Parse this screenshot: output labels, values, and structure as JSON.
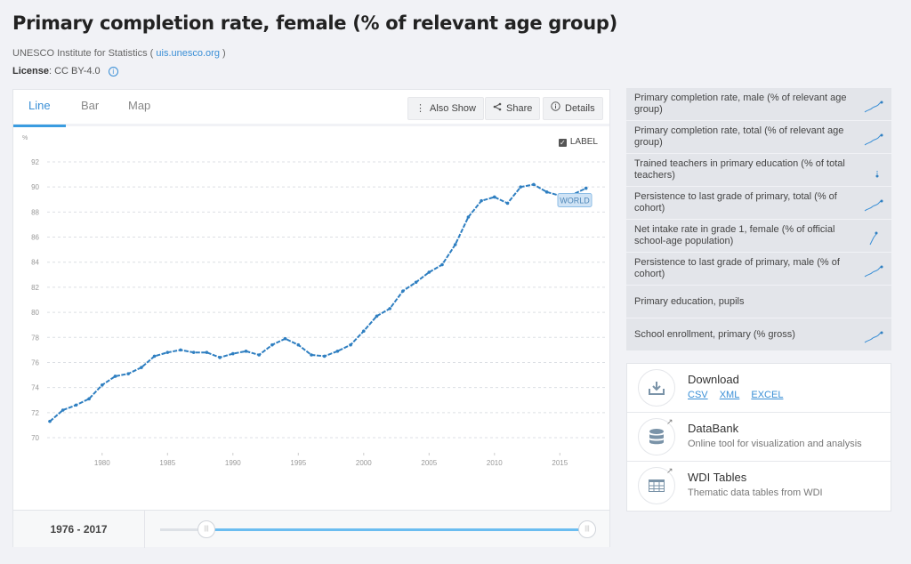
{
  "page": {
    "title": "Primary completion rate, female (% of relevant age group)",
    "source_prefix": "UNESCO Institute for Statistics (",
    "source_link": "uis.unesco.org",
    "source_suffix": ")",
    "license_label": "License",
    "license_value": ": CC BY-4.0"
  },
  "tabs": [
    {
      "label": "Line",
      "active": true
    },
    {
      "label": "Bar",
      "active": false
    },
    {
      "label": "Map",
      "active": false
    }
  ],
  "toolbar": {
    "also_show": "Also Show",
    "share": "Share",
    "details": "Details",
    "label_toggle": "LABEL",
    "label_checked": true
  },
  "footer": {
    "range_start": "1976",
    "range_end": "2017",
    "range_text": "1976 - 2017"
  },
  "colors": {
    "accent": "#3a8fd6",
    "line": "#2f7fc1",
    "slider_fill": "#6bbdf0"
  },
  "chart_data": {
    "type": "line",
    "title": "Primary completion rate, female (% of relevant age group)",
    "xlabel": "",
    "ylabel": "%",
    "ylim": [
      70,
      92
    ],
    "xlim": [
      1976,
      2017
    ],
    "yticks": [
      70,
      72,
      74,
      76,
      78,
      80,
      82,
      84,
      86,
      88,
      90,
      92
    ],
    "xticks": [
      1980,
      1985,
      1990,
      1995,
      2000,
      2005,
      2010,
      2015
    ],
    "grid": true,
    "series": [
      {
        "name": "WORLD",
        "x": [
          1976,
          1977,
          1978,
          1979,
          1980,
          1981,
          1982,
          1983,
          1984,
          1985,
          1986,
          1987,
          1988,
          1989,
          1990,
          1991,
          1992,
          1993,
          1994,
          1995,
          1996,
          1997,
          1998,
          1999,
          2000,
          2001,
          2002,
          2003,
          2004,
          2005,
          2006,
          2007,
          2008,
          2009,
          2010,
          2011,
          2012,
          2013,
          2014,
          2015,
          2016,
          2017
        ],
        "values": [
          71.3,
          72.2,
          72.6,
          73.1,
          74.2,
          74.9,
          75.1,
          75.6,
          76.5,
          76.8,
          77.0,
          76.8,
          76.8,
          76.4,
          76.7,
          76.9,
          76.6,
          77.4,
          77.9,
          77.4,
          76.6,
          76.5,
          76.9,
          77.4,
          78.5,
          79.7,
          80.3,
          81.7,
          82.4,
          83.2,
          83.8,
          85.4,
          87.6,
          88.9,
          89.2,
          88.7,
          90.0,
          90.2,
          89.6,
          89.3,
          89.4,
          89.9
        ]
      }
    ],
    "annotations": [
      {
        "text": "WORLD",
        "x": 2016,
        "y": 89.4
      }
    ]
  },
  "related": [
    {
      "label": "Primary completion rate, male (% of relevant age group)",
      "spark": "up"
    },
    {
      "label": "Primary completion rate, total (% of relevant age group)",
      "spark": "up"
    },
    {
      "label": "Trained teachers in primary education (% of total teachers)",
      "spark": "dot"
    },
    {
      "label": "Persistence to last grade of primary, total (% of cohort)",
      "spark": "up"
    },
    {
      "label": "Net intake rate in grade 1, female (% of official school-age population)",
      "spark": "steep"
    },
    {
      "label": "Persistence to last grade of primary, male (% of cohort)",
      "spark": "up"
    },
    {
      "label": "Primary education, pupils",
      "spark": "none"
    },
    {
      "label": "School enrollment, primary (% gross)",
      "spark": "up"
    }
  ],
  "tools": {
    "download": {
      "title": "Download",
      "links": [
        "CSV",
        "XML",
        "EXCEL"
      ]
    },
    "databank": {
      "title": "DataBank",
      "subtitle": "Online tool for visualization and analysis"
    },
    "wdi": {
      "title": "WDI Tables",
      "subtitle": "Thematic data tables from WDI"
    }
  }
}
